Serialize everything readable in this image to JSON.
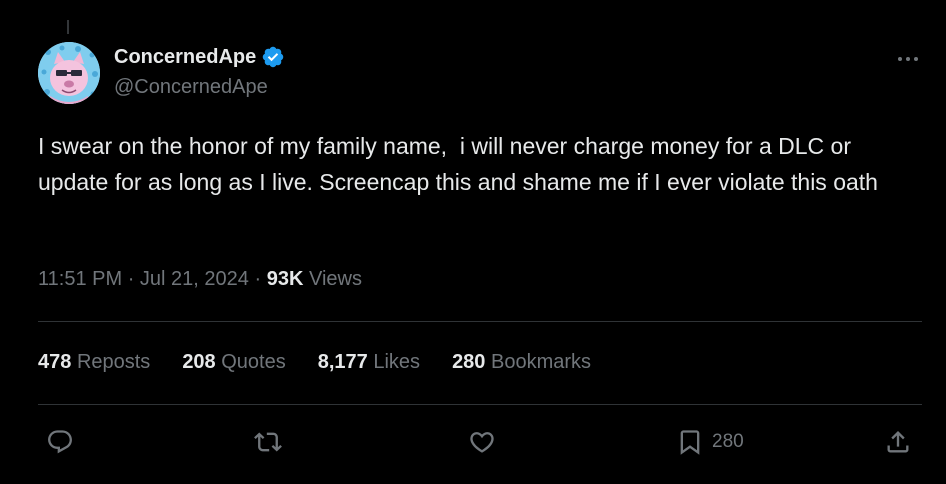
{
  "author": {
    "display_name": "ConcernedApe",
    "handle": "@ConcernedApe",
    "verified": true
  },
  "tweet": {
    "text": "I swear on the honor of my family name,  i will never charge money for a DLC or update for as long as I live. Screencap this and shame me if I ever violate this oath",
    "time": "11:51 PM",
    "separator": "·",
    "date": "Jul 21, 2024",
    "views_count": "93K",
    "views_label": "Views"
  },
  "stats": [
    {
      "count": "478",
      "label": "Reposts"
    },
    {
      "count": "208",
      "label": "Quotes"
    },
    {
      "count": "8,177",
      "label": "Likes"
    },
    {
      "count": "280",
      "label": "Bookmarks"
    }
  ],
  "actions": {
    "reply": {
      "icon": "reply-icon"
    },
    "repost": {
      "icon": "repost-icon"
    },
    "like": {
      "icon": "heart-icon"
    },
    "bookmark": {
      "icon": "bookmark-icon",
      "count": "280"
    },
    "share": {
      "icon": "share-icon"
    }
  },
  "colors": {
    "background": "#000000",
    "text_primary": "#e7e9ea",
    "text_secondary": "#71767b",
    "divider": "#2f3336",
    "verified": "#1d9bf0"
  }
}
